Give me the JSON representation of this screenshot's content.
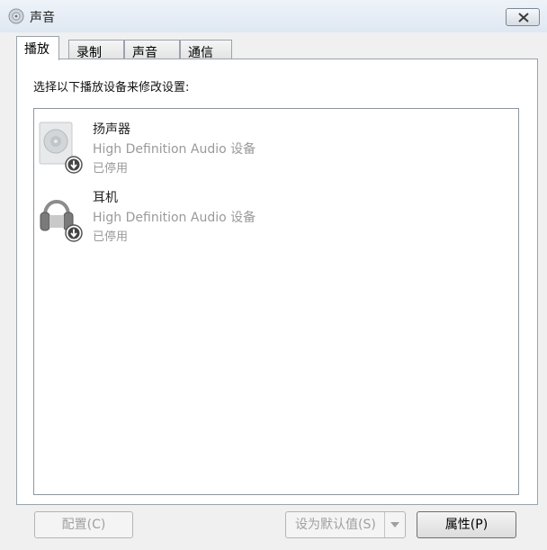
{
  "window": {
    "title": "声音",
    "title_icon": "speaker-icon",
    "close_icon": "close-icon"
  },
  "tabs": [
    {
      "label": "播放",
      "active": true
    },
    {
      "label": "录制",
      "active": false
    },
    {
      "label": "声音",
      "active": false
    },
    {
      "label": "通信",
      "active": false
    }
  ],
  "main": {
    "instruction": "选择以下播放设备来修改设置:",
    "devices": [
      {
        "name": "扬声器",
        "description": "High Definition Audio 设备",
        "status": "已停用",
        "icon": "speaker-device-icon",
        "badge_icon": "disabled-arrow-icon"
      },
      {
        "name": "耳机",
        "description": "High Definition Audio 设备",
        "status": "已停用",
        "icon": "headphones-icon",
        "badge_icon": "disabled-arrow-icon"
      }
    ]
  },
  "buttons": {
    "configure": "配置(C)",
    "set_default": "设为默认值(S)",
    "properties": "属性(P)"
  },
  "colors": {
    "disabled_text": "#9a9a9a",
    "panel_background": "#ffffff",
    "window_background": "#f0f0f0"
  }
}
